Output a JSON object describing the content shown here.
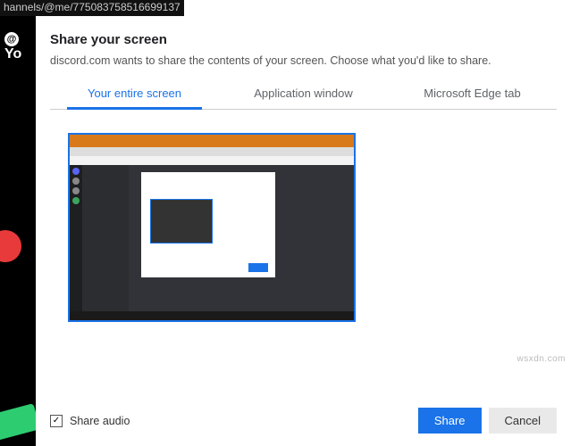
{
  "background": {
    "url_fragment": "hannels/@me/775083758516699137",
    "header_text": "Yo"
  },
  "modal": {
    "title": "Share your screen",
    "description": "discord.com wants to share the contents of your screen. Choose what you'd like to share.",
    "tabs": {
      "entire_screen": "Your entire screen",
      "app_window": "Application window",
      "edge_tab": "Microsoft Edge tab"
    },
    "share_audio_label": "Share audio",
    "share_button": "Share",
    "cancel_button": "Cancel"
  },
  "watermark": "wsxdn.com"
}
